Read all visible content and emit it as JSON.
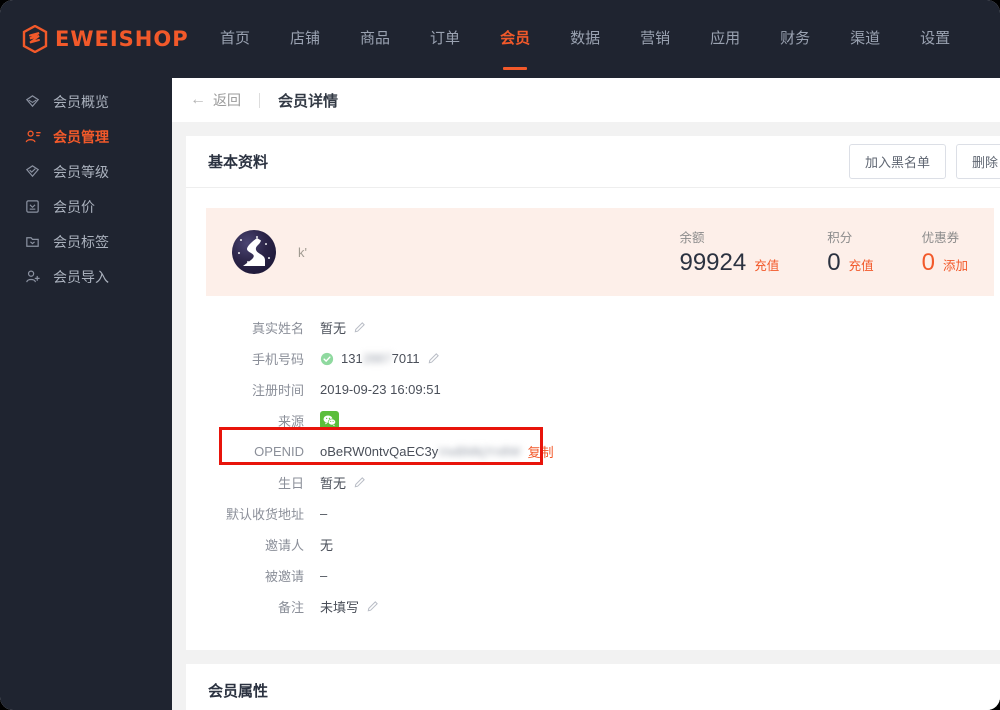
{
  "brand": {
    "name": "EWEISHOP",
    "logo_icon": "hexagon-s-icon",
    "color": "#f2592a"
  },
  "topnav": {
    "items": [
      {
        "label": "首页",
        "active": false
      },
      {
        "label": "店铺",
        "active": false
      },
      {
        "label": "商品",
        "active": false
      },
      {
        "label": "订单",
        "active": false
      },
      {
        "label": "会员",
        "active": true
      },
      {
        "label": "数据",
        "active": false
      },
      {
        "label": "营销",
        "active": false
      },
      {
        "label": "应用",
        "active": false
      },
      {
        "label": "财务",
        "active": false
      },
      {
        "label": "渠道",
        "active": false
      },
      {
        "label": "设置",
        "active": false
      }
    ]
  },
  "sidebar": {
    "items": [
      {
        "label": "会员概览",
        "icon": "diamond-icon",
        "active": false
      },
      {
        "label": "会员管理",
        "icon": "user-card-icon",
        "active": true
      },
      {
        "label": "会员等级",
        "icon": "diamond-check-icon",
        "active": false
      },
      {
        "label": "会员价",
        "icon": "price-tag-icon",
        "active": false
      },
      {
        "label": "会员标签",
        "icon": "folder-tag-icon",
        "active": false
      },
      {
        "label": "会员导入",
        "icon": "user-plus-icon",
        "active": false
      }
    ]
  },
  "pagebar": {
    "back_label": "返回",
    "back_icon": "arrow-left-icon",
    "title": "会员详情"
  },
  "basic_card": {
    "title": "基本资料",
    "actions": [
      {
        "label": "加入黑名单"
      },
      {
        "label": "删除"
      }
    ],
    "profile": {
      "avatar_icon": "user-avatar-image",
      "username": "k'"
    },
    "stats": [
      {
        "label": "余额",
        "value": "99924",
        "action": "充值",
        "value_color": "#2b3240"
      },
      {
        "label": "积分",
        "value": "0",
        "action": "充值",
        "value_color": "#2b3240"
      },
      {
        "label": "优惠券",
        "value": "0",
        "action": "添加",
        "value_color": "#f2592a"
      }
    ],
    "rows": [
      {
        "key": "真实姓名",
        "value": "暂无",
        "editable": true
      },
      {
        "key": "手机号码",
        "value": "131",
        "value_blurred": "2887",
        "value_tail": "7011",
        "verified": true,
        "editable": true
      },
      {
        "key": "注册时间",
        "value": "2019-09-23 16:09:51",
        "editable": false
      },
      {
        "key": "来源",
        "value": "",
        "source_icon": "wechat-icon",
        "editable": false
      },
      {
        "key": "OPENID",
        "value": "oBeRW0ntvQaEC3y",
        "value_blurred": "VwBMkjYn8W",
        "copy_label": "复制",
        "editable": false,
        "highlighted": true
      },
      {
        "key": "生日",
        "value": "暂无",
        "editable": true
      },
      {
        "key": "默认收货地址",
        "value": "–",
        "editable": false
      },
      {
        "key": "邀请人",
        "value": "无",
        "editable": false
      },
      {
        "key": "被邀请",
        "value": "–",
        "editable": false
      },
      {
        "key": "备注",
        "value": "未填写",
        "editable": true
      }
    ]
  },
  "attributes_card": {
    "title": "会员属性"
  },
  "annotation": {
    "shape": "rectangle",
    "color": "#e8140b",
    "target": "OPENID"
  }
}
